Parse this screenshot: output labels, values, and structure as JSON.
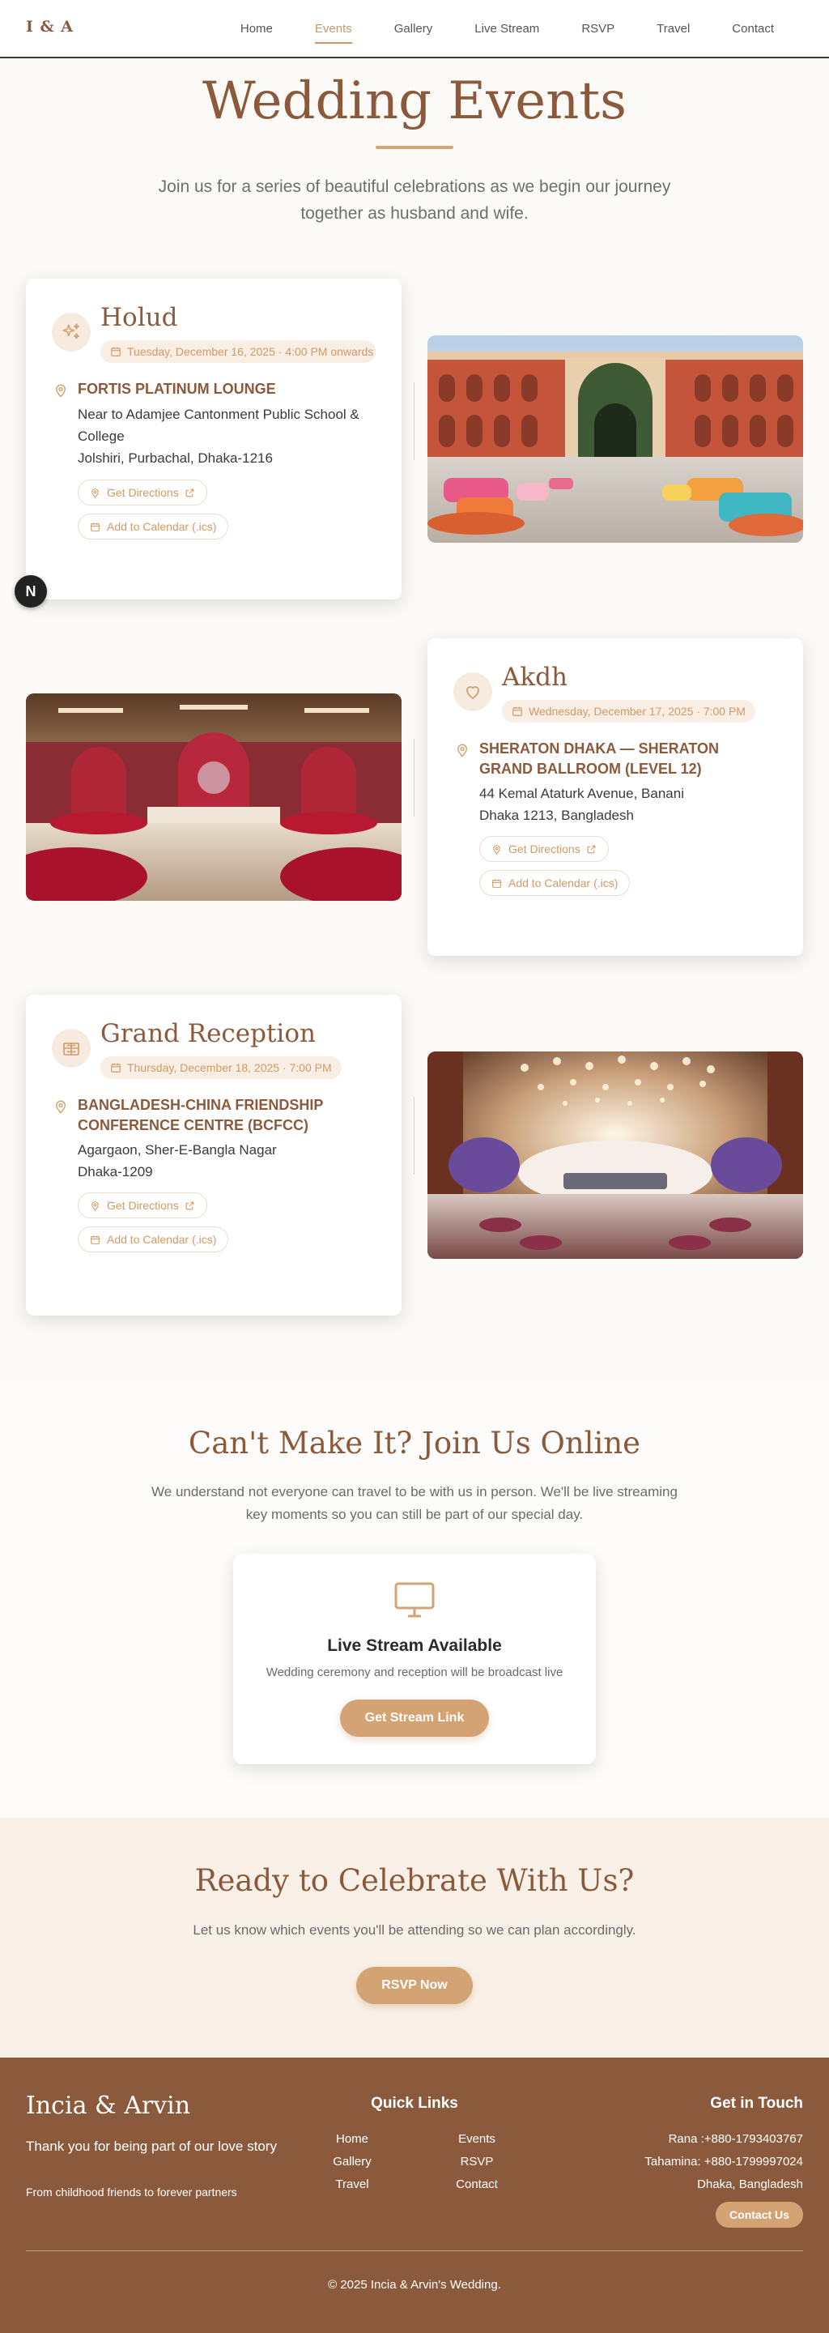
{
  "nav": {
    "logo": "I & A",
    "links": [
      "Home",
      "Events",
      "Gallery",
      "Live Stream",
      "RSVP",
      "Travel",
      "Contact"
    ],
    "active": "Events"
  },
  "hero": {
    "title": "Wedding Events",
    "subtitle": "Join us for a series of beautiful celebrations as we begin our journey together as husband and wife."
  },
  "events": [
    {
      "icon": "sparkles-icon",
      "title": "Holud",
      "date": "Tuesday, December 16, 2025 · 4:00 PM onwards",
      "venue": "FORTIS PLATINUM LOUNGE",
      "address": [
        "Near to Adamjee Cantonment Public School & College",
        "Jolshiri, Purbachal, Dhaka-1216"
      ],
      "directions": "Get Directions",
      "calendar": "Add to Calendar (.ics)"
    },
    {
      "icon": "heart-icon",
      "title": "Akdh",
      "date": "Wednesday, December 17, 2025 · 7:00 PM",
      "venue": "SHERATON DHAKA — SHERATON GRAND BALLROOM (LEVEL 12)",
      "address": [
        "44 Kemal Ataturk Avenue, Banani",
        "Dhaka 1213, Bangladesh"
      ],
      "directions": "Get Directions",
      "calendar": "Add to Calendar (.ics)"
    },
    {
      "icon": "gift-icon",
      "title": "Grand Reception",
      "date": "Thursday, December 18, 2025 · 7:00 PM",
      "venue": "BANGLADESH-CHINA FRIENDSHIP CONFERENCE CENTRE (BCFCC)",
      "address": [
        "Agargaon, Sher-E-Bangla Nagar",
        "Dhaka-1209"
      ],
      "directions": "Get Directions",
      "calendar": "Add to Calendar (.ics)"
    }
  ],
  "badge": "N",
  "online": {
    "title": "Can't Make It? Join Us Online",
    "text": "We understand not everyone can travel to be with us in person. We'll be live streaming key moments so you can still be part of our special day.",
    "card_title": "Live Stream Available",
    "card_text": "Wedding ceremony and reception will be broadcast live",
    "button": "Get Stream Link"
  },
  "rsvp": {
    "title": "Ready to Celebrate With Us?",
    "text": "Let us know which events you'll be attending so we can plan accordingly.",
    "button": "RSVP Now"
  },
  "footer": {
    "brand": "Incia & Arvin",
    "thanks": "Thank you for being part of our love story",
    "tagline": "From childhood friends to forever partners",
    "quick_links_title": "Quick Links",
    "quick_links": [
      "Home",
      "Events",
      "Gallery",
      "RSVP",
      "Travel",
      "Contact"
    ],
    "contact_title": "Get in Touch",
    "contacts": [
      "Rana :+880-1793403767",
      "Tahamina: +880-1799997024",
      "Dhaka, Bangladesh"
    ],
    "contact_button": "Contact Us",
    "copyright": "© 2025 Incia & Arvin's Wedding."
  },
  "colors": {
    "brand_brown": "#8b5a3c",
    "accent_tan": "#d4a373",
    "badge_bg": "#f9eee4",
    "page_bg": "#fcfaf6"
  }
}
